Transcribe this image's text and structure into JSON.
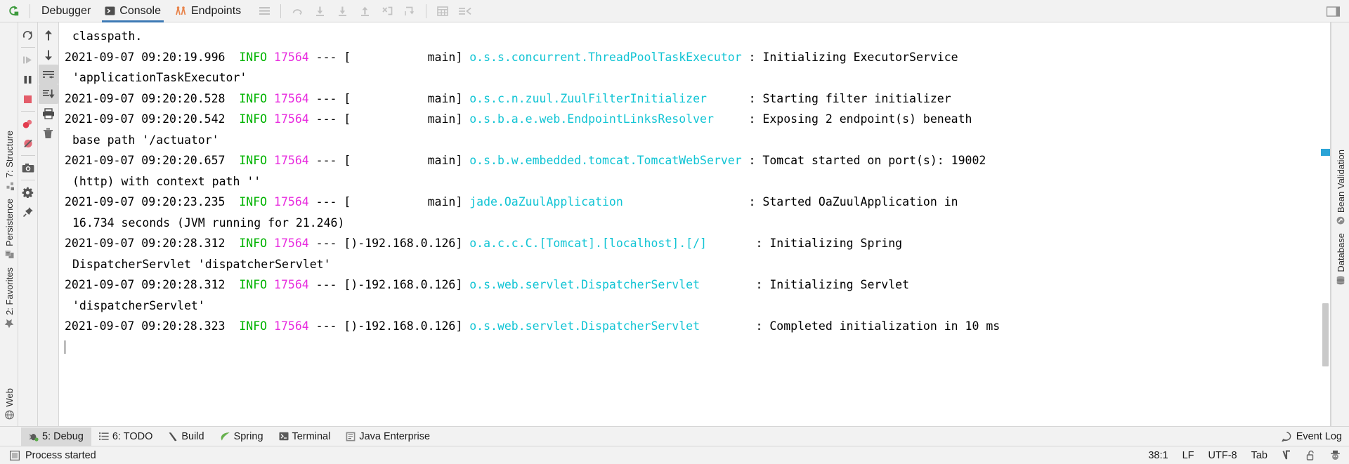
{
  "window": {
    "title": "IntelliJ IDEA Debug Console"
  },
  "toolbar": {
    "rerun_icon": "rerun-icon",
    "tabs": [
      {
        "id": "debugger",
        "label": "Debugger",
        "icon": "debugger-icon",
        "active": false
      },
      {
        "id": "console",
        "label": "Console",
        "icon": "console-icon",
        "active": true
      },
      {
        "id": "endpoints",
        "label": "Endpoints",
        "icon": "endpoints-icon",
        "active": false
      }
    ],
    "actions": [
      {
        "id": "layout",
        "icon": "layout-settings-icon",
        "label": "Layout Settings"
      },
      {
        "id": "step-over",
        "icon": "step-over-icon",
        "label": "Step Over"
      },
      {
        "id": "step-into",
        "icon": "step-into-icon",
        "label": "Step Into"
      },
      {
        "id": "force-step-into",
        "icon": "force-step-into-icon",
        "label": "Force Step Into"
      },
      {
        "id": "step-out",
        "icon": "step-out-icon",
        "label": "Step Out"
      },
      {
        "id": "drop-frame",
        "icon": "drop-frame-icon",
        "label": "Drop Frame"
      },
      {
        "id": "run-to-cursor",
        "icon": "run-to-cursor-icon",
        "label": "Run to Cursor"
      },
      {
        "id": "evaluate",
        "icon": "evaluate-expression-icon",
        "label": "Evaluate Expression"
      },
      {
        "id": "watches",
        "icon": "watches-icon",
        "label": "Watches"
      }
    ],
    "minimize_icon": "minimize-tool-window-icon"
  },
  "run_controls": [
    {
      "id": "rerun",
      "icon": "rerun-icon",
      "label": "Rerun"
    },
    {
      "id": "resume",
      "icon": "resume-program-icon",
      "label": "Resume Program"
    },
    {
      "id": "pause",
      "icon": "pause-program-icon",
      "label": "Pause Program"
    },
    {
      "id": "stop",
      "icon": "stop-icon",
      "label": "Stop"
    },
    {
      "id": "view-breakpoints",
      "icon": "view-breakpoints-icon",
      "label": "View Breakpoints"
    },
    {
      "id": "mute-breakpoints",
      "icon": "mute-breakpoints-icon",
      "label": "Mute Breakpoints"
    },
    {
      "id": "get-thread-dump",
      "icon": "camera-icon",
      "label": "Get Thread Dump"
    },
    {
      "id": "settings",
      "icon": "gear-icon",
      "label": "Settings"
    },
    {
      "id": "pin-tab",
      "icon": "pin-icon",
      "label": "Pin Tab"
    }
  ],
  "console_controls": [
    {
      "id": "up-stack",
      "icon": "arrow-up-icon",
      "label": "Up the Stack Trace"
    },
    {
      "id": "down-stack",
      "icon": "arrow-down-icon",
      "label": "Down the Stack Trace"
    },
    {
      "id": "soft-wrap",
      "icon": "soft-wrap-icon",
      "label": "Use Soft Wraps",
      "selected": true
    },
    {
      "id": "scroll-to-end",
      "icon": "scroll-to-end-icon",
      "label": "Scroll to the End",
      "selected": true
    },
    {
      "id": "print",
      "icon": "print-icon",
      "label": "Print"
    },
    {
      "id": "clear-all",
      "icon": "trash-icon",
      "label": "Clear All"
    }
  ],
  "left_tool_window": {
    "items": [
      {
        "id": "structure",
        "label": "7: Structure",
        "number": "7",
        "icon": "structure-icon"
      },
      {
        "id": "persistence",
        "label": "Persistence",
        "number": "",
        "icon": "persistence-icon"
      },
      {
        "id": "favorites",
        "label": "2: Favorites",
        "number": "2",
        "icon": "favorites-icon"
      },
      {
        "id": "web",
        "label": "Web",
        "number": "",
        "icon": "web-icon"
      }
    ]
  },
  "right_tool_window": {
    "items": [
      {
        "id": "bean-validation",
        "label": "Bean Validation",
        "icon": "bean-validation-icon"
      },
      {
        "id": "database",
        "label": "Database",
        "icon": "database-icon"
      }
    ]
  },
  "console_output": {
    "lines": [
      {
        "indent": 1,
        "segments": [
          {
            "t": "classpath.",
            "c": "plain"
          }
        ]
      },
      {
        "indent": 0,
        "segments": [
          {
            "t": "2021-09-07 09:20:19.996  ",
            "c": "plain"
          },
          {
            "t": "INFO",
            "c": "info"
          },
          {
            "t": " ",
            "c": "plain"
          },
          {
            "t": "17564",
            "c": "pid"
          },
          {
            "t": " --- [           main] ",
            "c": "plain"
          },
          {
            "t": "o.s.s.concurrent.ThreadPoolTaskExecutor",
            "c": "log"
          },
          {
            "t": " : Initializing ExecutorService",
            "c": "plain"
          }
        ]
      },
      {
        "indent": 1,
        "segments": [
          {
            "t": "'applicationTaskExecutor'",
            "c": "plain"
          }
        ]
      },
      {
        "indent": 0,
        "segments": [
          {
            "t": "2021-09-07 09:20:20.528  ",
            "c": "plain"
          },
          {
            "t": "INFO",
            "c": "info"
          },
          {
            "t": " ",
            "c": "plain"
          },
          {
            "t": "17564",
            "c": "pid"
          },
          {
            "t": " --- [           main] ",
            "c": "plain"
          },
          {
            "t": "o.s.c.n.zuul.ZuulFilterInitializer",
            "c": "log"
          },
          {
            "t": "      : Starting filter initializer",
            "c": "plain"
          }
        ]
      },
      {
        "indent": 0,
        "segments": [
          {
            "t": "2021-09-07 09:20:20.542  ",
            "c": "plain"
          },
          {
            "t": "INFO",
            "c": "info"
          },
          {
            "t": " ",
            "c": "plain"
          },
          {
            "t": "17564",
            "c": "pid"
          },
          {
            "t": " --- [           main] ",
            "c": "plain"
          },
          {
            "t": "o.s.b.a.e.web.EndpointLinksResolver",
            "c": "log"
          },
          {
            "t": "     : Exposing 2 endpoint(s) beneath",
            "c": "plain"
          }
        ]
      },
      {
        "indent": 1,
        "segments": [
          {
            "t": "base path '/actuator'",
            "c": "plain"
          }
        ]
      },
      {
        "indent": 0,
        "segments": [
          {
            "t": "2021-09-07 09:20:20.657  ",
            "c": "plain"
          },
          {
            "t": "INFO",
            "c": "info"
          },
          {
            "t": " ",
            "c": "plain"
          },
          {
            "t": "17564",
            "c": "pid"
          },
          {
            "t": " --- [           main] ",
            "c": "plain"
          },
          {
            "t": "o.s.b.w.embedded.tomcat.TomcatWebServer",
            "c": "log"
          },
          {
            "t": " : Tomcat started on port(s): 19002",
            "c": "plain"
          }
        ]
      },
      {
        "indent": 1,
        "segments": [
          {
            "t": "(http) with context path ''",
            "c": "plain"
          }
        ]
      },
      {
        "indent": 0,
        "segments": [
          {
            "t": "2021-09-07 09:20:23.235  ",
            "c": "plain"
          },
          {
            "t": "INFO",
            "c": "info"
          },
          {
            "t": " ",
            "c": "plain"
          },
          {
            "t": "17564",
            "c": "pid"
          },
          {
            "t": " --- [           main] ",
            "c": "plain"
          },
          {
            "t": "jade.OaZuulApplication",
            "c": "log"
          },
          {
            "t": "                  : Started OaZuulApplication in",
            "c": "plain"
          }
        ]
      },
      {
        "indent": 1,
        "segments": [
          {
            "t": "16.734 seconds (JVM running for 21.246)",
            "c": "plain"
          }
        ]
      },
      {
        "indent": 0,
        "segments": [
          {
            "t": "2021-09-07 09:20:28.312  ",
            "c": "plain"
          },
          {
            "t": "INFO",
            "c": "info"
          },
          {
            "t": " ",
            "c": "plain"
          },
          {
            "t": "17564",
            "c": "pid"
          },
          {
            "t": " --- [)-192.168.0.126] ",
            "c": "plain"
          },
          {
            "t": "o.a.c.c.C.[Tomcat].[localhost].[/]",
            "c": "log"
          },
          {
            "t": "       : Initializing Spring",
            "c": "plain"
          }
        ]
      },
      {
        "indent": 1,
        "segments": [
          {
            "t": "DispatcherServlet 'dispatcherServlet'",
            "c": "plain"
          }
        ]
      },
      {
        "indent": 0,
        "segments": [
          {
            "t": "2021-09-07 09:20:28.312  ",
            "c": "plain"
          },
          {
            "t": "INFO",
            "c": "info"
          },
          {
            "t": " ",
            "c": "plain"
          },
          {
            "t": "17564",
            "c": "pid"
          },
          {
            "t": " --- [)-192.168.0.126] ",
            "c": "plain"
          },
          {
            "t": "o.s.web.servlet.DispatcherServlet",
            "c": "log"
          },
          {
            "t": "        : Initializing Servlet",
            "c": "plain"
          }
        ]
      },
      {
        "indent": 1,
        "segments": [
          {
            "t": "'dispatcherServlet'",
            "c": "plain"
          }
        ]
      },
      {
        "indent": 0,
        "segments": [
          {
            "t": "2021-09-07 09:20:28.323  ",
            "c": "plain"
          },
          {
            "t": "INFO",
            "c": "info"
          },
          {
            "t": " ",
            "c": "plain"
          },
          {
            "t": "17564",
            "c": "pid"
          },
          {
            "t": " --- [)-192.168.0.126] ",
            "c": "plain"
          },
          {
            "t": "o.s.web.servlet.DispatcherServlet",
            "c": "log"
          },
          {
            "t": "        : Completed initialization in 10 ms",
            "c": "plain"
          }
        ]
      },
      {
        "indent": 0,
        "segments": [
          {
            "t": "",
            "c": "caret"
          }
        ]
      }
    ]
  },
  "bottom_tool_window": {
    "items": [
      {
        "id": "debug",
        "label": "5: Debug",
        "number": "5",
        "icon": "debug-icon",
        "selected": true
      },
      {
        "id": "todo",
        "label": "6: TODO",
        "number": "6",
        "icon": "todo-icon",
        "selected": false
      },
      {
        "id": "build",
        "label": "Build",
        "number": "",
        "icon": "build-icon",
        "selected": false
      },
      {
        "id": "spring",
        "label": "Spring",
        "number": "",
        "icon": "spring-icon",
        "selected": false
      },
      {
        "id": "terminal",
        "label": "Terminal",
        "number": "",
        "icon": "terminal-icon",
        "selected": false
      },
      {
        "id": "java-enterprise",
        "label": "Java Enterprise",
        "number": "",
        "icon": "java-enterprise-icon",
        "selected": false
      }
    ],
    "event_log": {
      "label": "Event Log",
      "icon": "event-log-icon"
    }
  },
  "status_bar": {
    "message": "Process started",
    "message_icon": "process-icon",
    "caret_position": "38:1",
    "line_separator": "LF",
    "encoding": "UTF-8",
    "indent": "Tab",
    "vcs_icon": "git-branch-icon",
    "lock_icon": "unlocked-icon",
    "inspections_icon": "hector-icon"
  },
  "colors": {
    "accent": "#3d7ab5",
    "info": "#00b300",
    "pid": "#e82bde",
    "logger": "#11c4d4",
    "chrome": "#f2f2f2",
    "console_bg": "#ffffff",
    "scroll_marker": "#2aa3d6"
  }
}
